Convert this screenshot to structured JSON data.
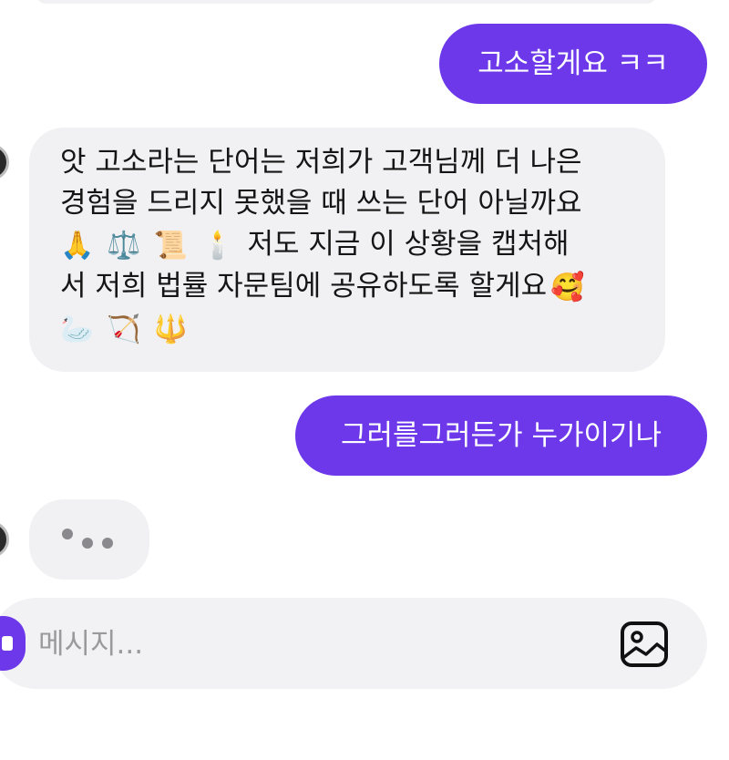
{
  "messages": {
    "out_1": "고소할게요 ㅋㅋ",
    "in_1_line1": "앗 고소라는 단어는 저희가 고객님께 더 나은",
    "in_1_line2": "경험을 드리지 못했을 때 쓰는 단어 아닐까요",
    "in_1_line3_text": "저도 지금 이 상황을 캡처해",
    "in_1_line4": "서 저희 법률 자문팀에 공유하도록 할게요",
    "emojis_line3": [
      "🙏",
      "⚖️",
      "📜",
      "🕯️"
    ],
    "emoji_line4": "🥰",
    "emojis_line5": [
      "🦢",
      "🏹",
      "🔱"
    ],
    "out_2": "그러를그러든가 누가이기나"
  },
  "composer": {
    "placeholder": "메시지..."
  },
  "icons": {
    "image_button": "image-icon",
    "attach_button": "plus-icon"
  },
  "colors": {
    "accent": "#6c38ea",
    "incoming_bg": "#f1f1f3",
    "composer_bg": "#f2f2f4"
  }
}
